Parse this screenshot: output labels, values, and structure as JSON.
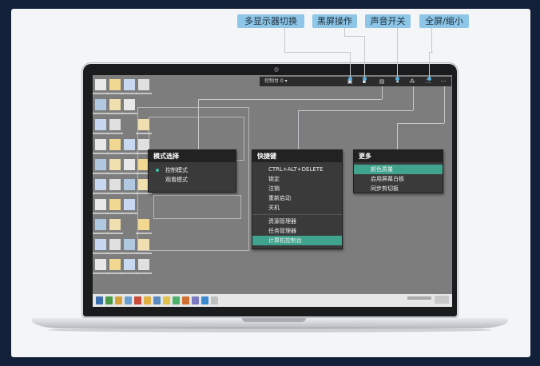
{
  "callouts": {
    "multi_monitor": "多显示器切换",
    "black_screen": "黑屏操作",
    "sound": "声音开关",
    "fullscreen": "全屏/缩小"
  },
  "toolbar": {
    "console_label": "控制台 0 ▾"
  },
  "mode_menu": {
    "title": "模式选择",
    "items": [
      "控制模式",
      "观看模式"
    ],
    "selected": "控制模式"
  },
  "shortcut_menu": {
    "title": "快捷键",
    "group1": [
      "CTRL+ALT+DELETE",
      "锁定",
      "注销",
      "重新启动",
      "关机"
    ],
    "group2": [
      "资源管理器",
      "任务管理器",
      "计算机控制台"
    ],
    "highlighted": "计算机控制台"
  },
  "more_menu": {
    "title": "更多",
    "items": [
      "颜色质量",
      "启用屏幕白板",
      "同步剪切板"
    ],
    "highlighted": "颜色质量"
  },
  "colors": {
    "callout_bg": "#8dc6e6",
    "highlight": "#3fa38e",
    "menu_bg": "#3a3a3a"
  }
}
